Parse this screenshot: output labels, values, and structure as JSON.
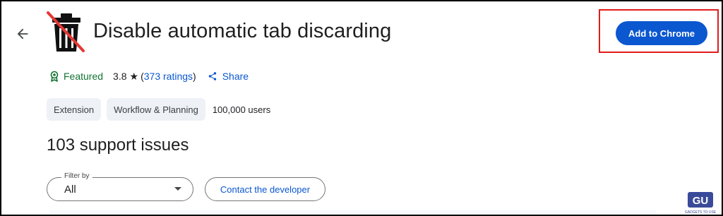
{
  "header": {
    "title": "Disable automatic tab discarding",
    "add_button_label": "Add to Chrome"
  },
  "meta": {
    "featured_label": "Featured",
    "rating_value": "3.8",
    "ratings_count_text": "373 ratings",
    "share_label": "Share"
  },
  "chips": {
    "type_label": "Extension",
    "category_label": "Workflow & Planning",
    "users_text": "100,000 users"
  },
  "support": {
    "heading": "103 support issues",
    "filter_label": "Filter by",
    "filter_value": "All",
    "contact_label": "Contact the developer"
  },
  "watermark": {
    "logo_text": "GU",
    "tagline": "GADGETS TO USE"
  },
  "colors": {
    "accent": "#0b57d0",
    "featured": "#137333",
    "highlight_box": "#e21b1b"
  },
  "icons": {
    "back": "arrow-left-icon",
    "extension": "trash-crossed-icon",
    "featured": "award-badge-icon",
    "star": "star-icon",
    "share": "share-icon",
    "dropdown": "caret-down-icon"
  }
}
